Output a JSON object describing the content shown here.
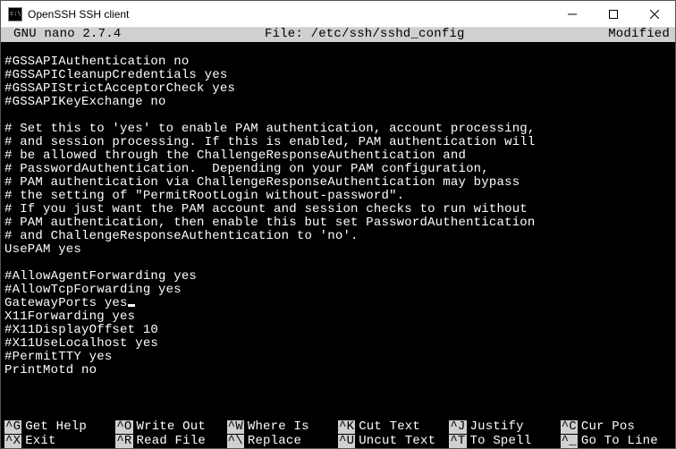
{
  "window": {
    "title": "OpenSSH SSH client"
  },
  "editor": {
    "app": "GNU nano 2.7.4",
    "file_label": "File: /etc/ssh/sshd_config",
    "modified": "Modified",
    "cursor_line_prefix": "GatewayPorts yes",
    "lines_before": [
      "",
      "#GSSAPIAuthentication no",
      "#GSSAPICleanupCredentials yes",
      "#GSSAPIStrictAcceptorCheck yes",
      "#GSSAPIKeyExchange no",
      "",
      "# Set this to 'yes' to enable PAM authentication, account processing,",
      "# and session processing. If this is enabled, PAM authentication will",
      "# be allowed through the ChallengeResponseAuthentication and",
      "# PasswordAuthentication.  Depending on your PAM configuration,",
      "# PAM authentication via ChallengeResponseAuthentication may bypass",
      "# the setting of \"PermitRootLogin without-password\".",
      "# If you just want the PAM account and session checks to run without",
      "# PAM authentication, then enable this but set PasswordAuthentication",
      "# and ChallengeResponseAuthentication to 'no'.",
      "UsePAM yes",
      "",
      "#AllowAgentForwarding yes",
      "#AllowTcpForwarding yes"
    ],
    "lines_after": [
      "X11Forwarding yes",
      "#X11DisplayOffset 10",
      "#X11UseLocalhost yes",
      "#PermitTTY yes",
      "PrintMotd no"
    ]
  },
  "shortcuts": [
    {
      "key": "^G",
      "label": "Get Help"
    },
    {
      "key": "^O",
      "label": "Write Out"
    },
    {
      "key": "^W",
      "label": "Where Is"
    },
    {
      "key": "^K",
      "label": "Cut Text"
    },
    {
      "key": "^J",
      "label": "Justify"
    },
    {
      "key": "^C",
      "label": "Cur Pos"
    },
    {
      "key": "^X",
      "label": "Exit"
    },
    {
      "key": "^R",
      "label": "Read File"
    },
    {
      "key": "^\\",
      "label": "Replace"
    },
    {
      "key": "^U",
      "label": "Uncut Text"
    },
    {
      "key": "^T",
      "label": "To Spell"
    },
    {
      "key": "^_",
      "label": "Go To Line"
    }
  ]
}
